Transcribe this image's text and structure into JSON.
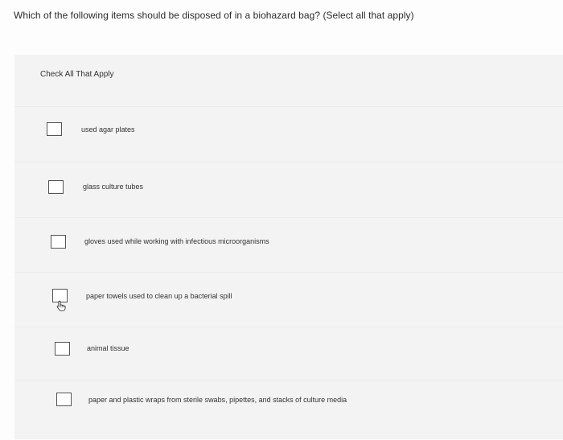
{
  "question": {
    "text": "Which of the following items should be disposed of in a biohazard bag? (Select all that apply)"
  },
  "panel": {
    "instruction": "Check All That Apply",
    "options": [
      {
        "label": "used agar plates",
        "checked": false
      },
      {
        "label": "glass culture tubes",
        "checked": false
      },
      {
        "label": "gloves used while working with infectious microorganisms",
        "checked": false
      },
      {
        "label": "paper towels used to clean up a bacterial spill",
        "checked": false
      },
      {
        "label": "animal tissue",
        "checked": false
      },
      {
        "label": "paper and plastic wraps from sterile swabs, pipettes, and stacks of culture media",
        "checked": false
      }
    ]
  },
  "icons": {
    "hand_cursor": "hand-pointer-icon"
  },
  "colors": {
    "panel_background": "#f3f3f3",
    "checkbox_border": "#555555"
  }
}
